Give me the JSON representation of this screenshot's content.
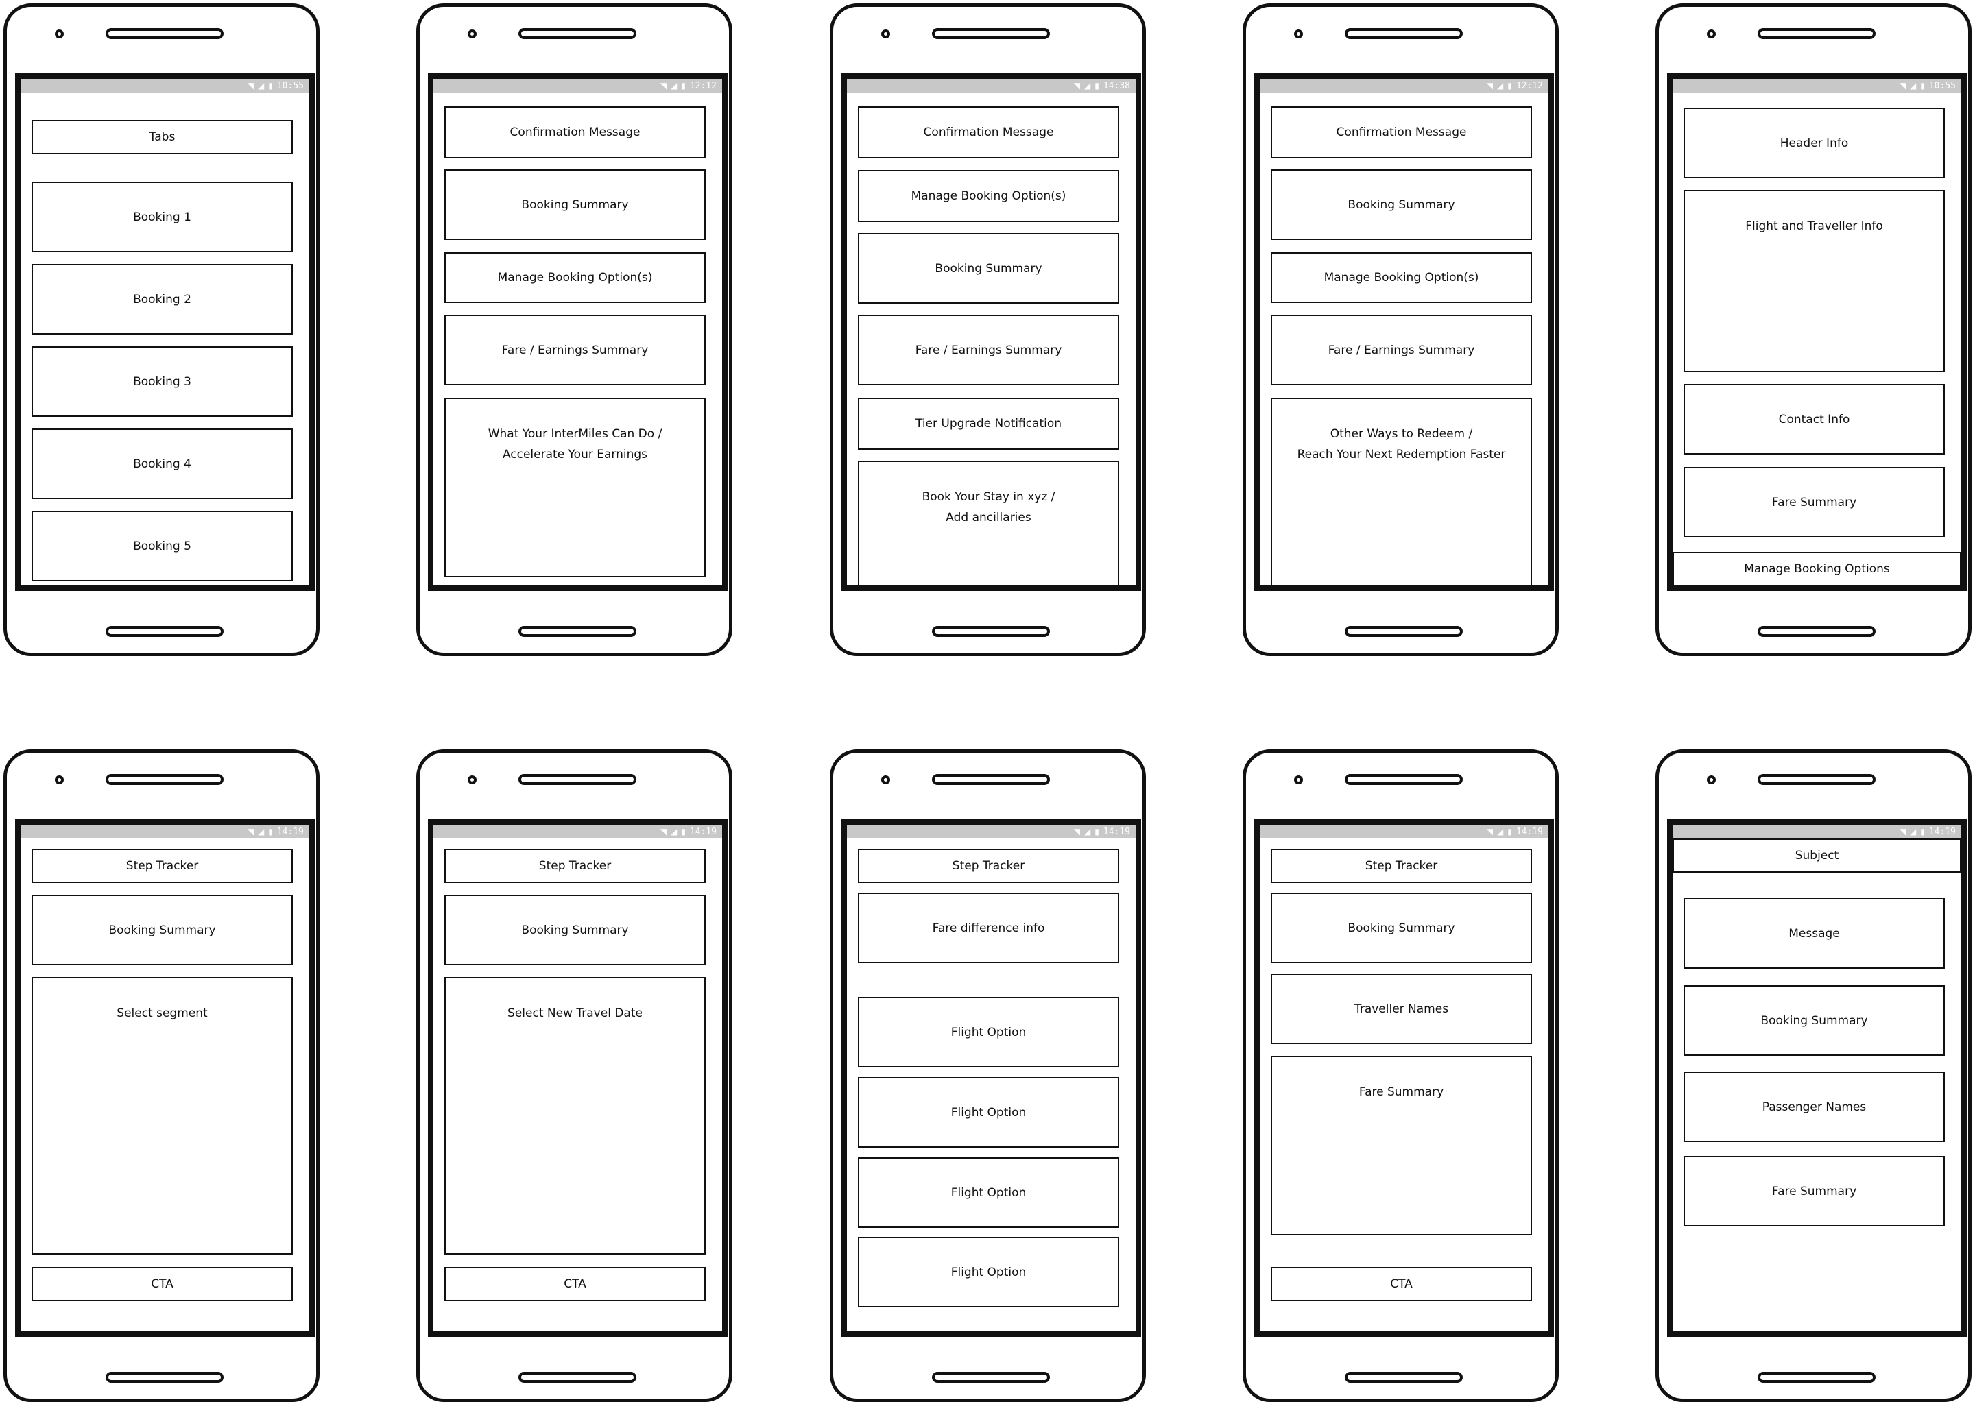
{
  "phones": [
    {
      "time": "10:55",
      "blocks": [
        "Tabs",
        "Booking 1",
        "Booking 2",
        "Booking 3",
        "Booking 4",
        "Booking 5"
      ]
    },
    {
      "time": "12:12",
      "blocks": [
        "Confirmation Message",
        "Booking Summary",
        "Manage Booking Option(s)",
        "Fare / Earnings Summary",
        "What Your InterMiles Can Do /\nAccelerate Your Earnings"
      ]
    },
    {
      "time": "14:38",
      "blocks": [
        "Confirmation Message",
        "Manage Booking Option(s)",
        "Booking Summary",
        "Fare / Earnings Summary",
        "Tier Upgrade Notification",
        "Book Your Stay in xyz /\nAdd ancillaries"
      ]
    },
    {
      "time": "12:12",
      "blocks": [
        "Confirmation Message",
        "Booking Summary",
        "Manage Booking Option(s)",
        "Fare / Earnings Summary",
        "Other Ways to Redeem /\nReach Your Next Redemption Faster"
      ]
    },
    {
      "time": "10:55",
      "blocks": [
        "Header Info",
        "Flight and Traveller Info",
        "Contact Info",
        "Fare Summary",
        "Manage Booking Options"
      ]
    },
    {
      "time": "14:19",
      "blocks": [
        "Step Tracker",
        "Booking Summary",
        "Select segment",
        "CTA"
      ]
    },
    {
      "time": "14:19",
      "blocks": [
        "Step Tracker",
        "Booking Summary",
        "Select New Travel Date",
        "CTA"
      ]
    },
    {
      "time": "14:19",
      "blocks": [
        "Step Tracker",
        "Fare difference info",
        "Flight Option",
        "Flight Option",
        "Flight Option",
        "Flight Option"
      ]
    },
    {
      "time": "14:19",
      "blocks": [
        "Step Tracker",
        "Booking Summary",
        "Traveller Names",
        "Fare Summary",
        "CTA"
      ]
    },
    {
      "time": "14:19",
      "blocks": [
        "Subject",
        "Message",
        "Booking Summary",
        "Passenger Names",
        "Fare Summary"
      ]
    }
  ]
}
